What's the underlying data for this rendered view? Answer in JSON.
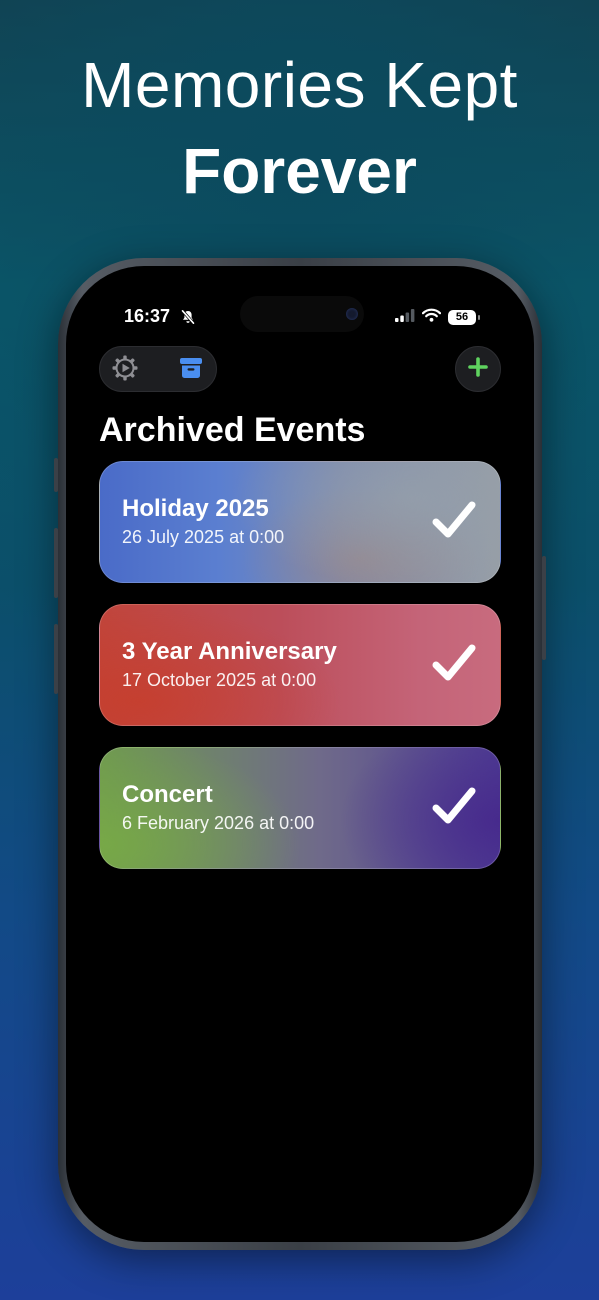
{
  "headline": {
    "line1": "Memories Kept",
    "line2": "Forever"
  },
  "status_bar": {
    "time": "16:37",
    "battery": "56",
    "icons": [
      "bell-slash-icon",
      "cellular-signal-icon",
      "wifi-icon",
      "battery-icon"
    ]
  },
  "toolbar": {
    "settings_icon": "gear-play-icon",
    "archive_icon": "archive-box-icon",
    "add_icon": "plus-icon"
  },
  "page": {
    "title": "Archived Events"
  },
  "events": [
    {
      "title": "Holiday 2025",
      "date": "26 July 2025 at 0:00"
    },
    {
      "title": "3 Year Anniversary",
      "date": "17 October 2025 at 0:00"
    },
    {
      "title": "Concert",
      "date": "6 February 2026 at 0:00"
    }
  ],
  "colors": {
    "archive_active": "#4a8ef0",
    "add_accent": "#5fd35f",
    "card_holiday": "#5b7fd0",
    "card_anniversary": "#bc4e5a",
    "card_concert": "#6f6a8a"
  }
}
